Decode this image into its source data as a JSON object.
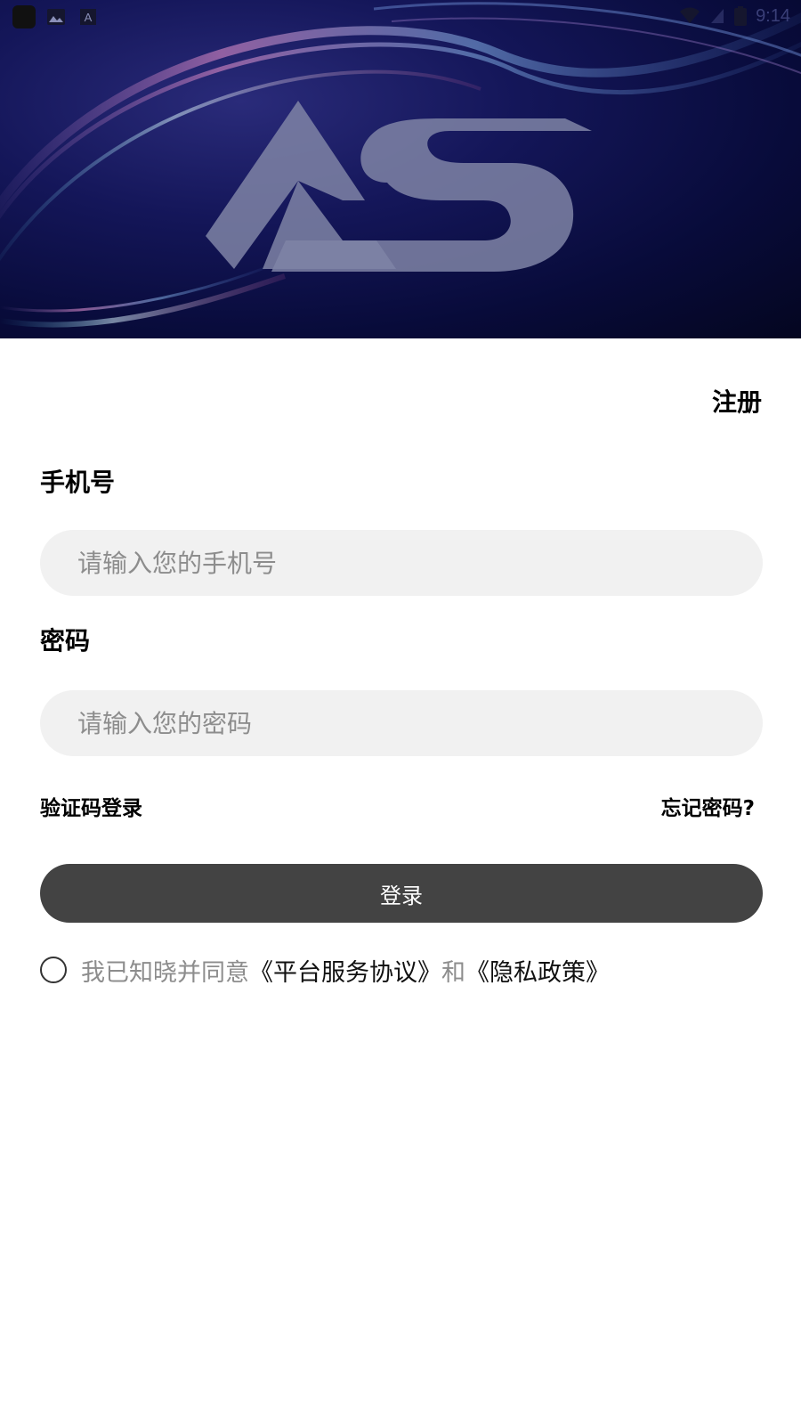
{
  "status_bar": {
    "time": "9:14"
  },
  "banner": {
    "logo_text": "AS"
  },
  "form": {
    "register_label": "注册",
    "phone_label": "手机号",
    "phone_placeholder": "请输入您的手机号",
    "password_label": "密码",
    "password_placeholder": "请输入您的密码",
    "code_login_label": "验证码登录",
    "forgot_password_label": "忘记密码?",
    "login_button_label": "登录"
  },
  "agreement": {
    "prefix": "我已知晓并同意",
    "terms_link": "《平台服务协议》",
    "conjunction": "和",
    "privacy_link": "《隐私政策》",
    "checked": false
  },
  "colors": {
    "banner_dark": "#080b3a",
    "input_bg": "#f1f1f1",
    "button_bg": "#434343",
    "placeholder": "#8d8d8d"
  }
}
